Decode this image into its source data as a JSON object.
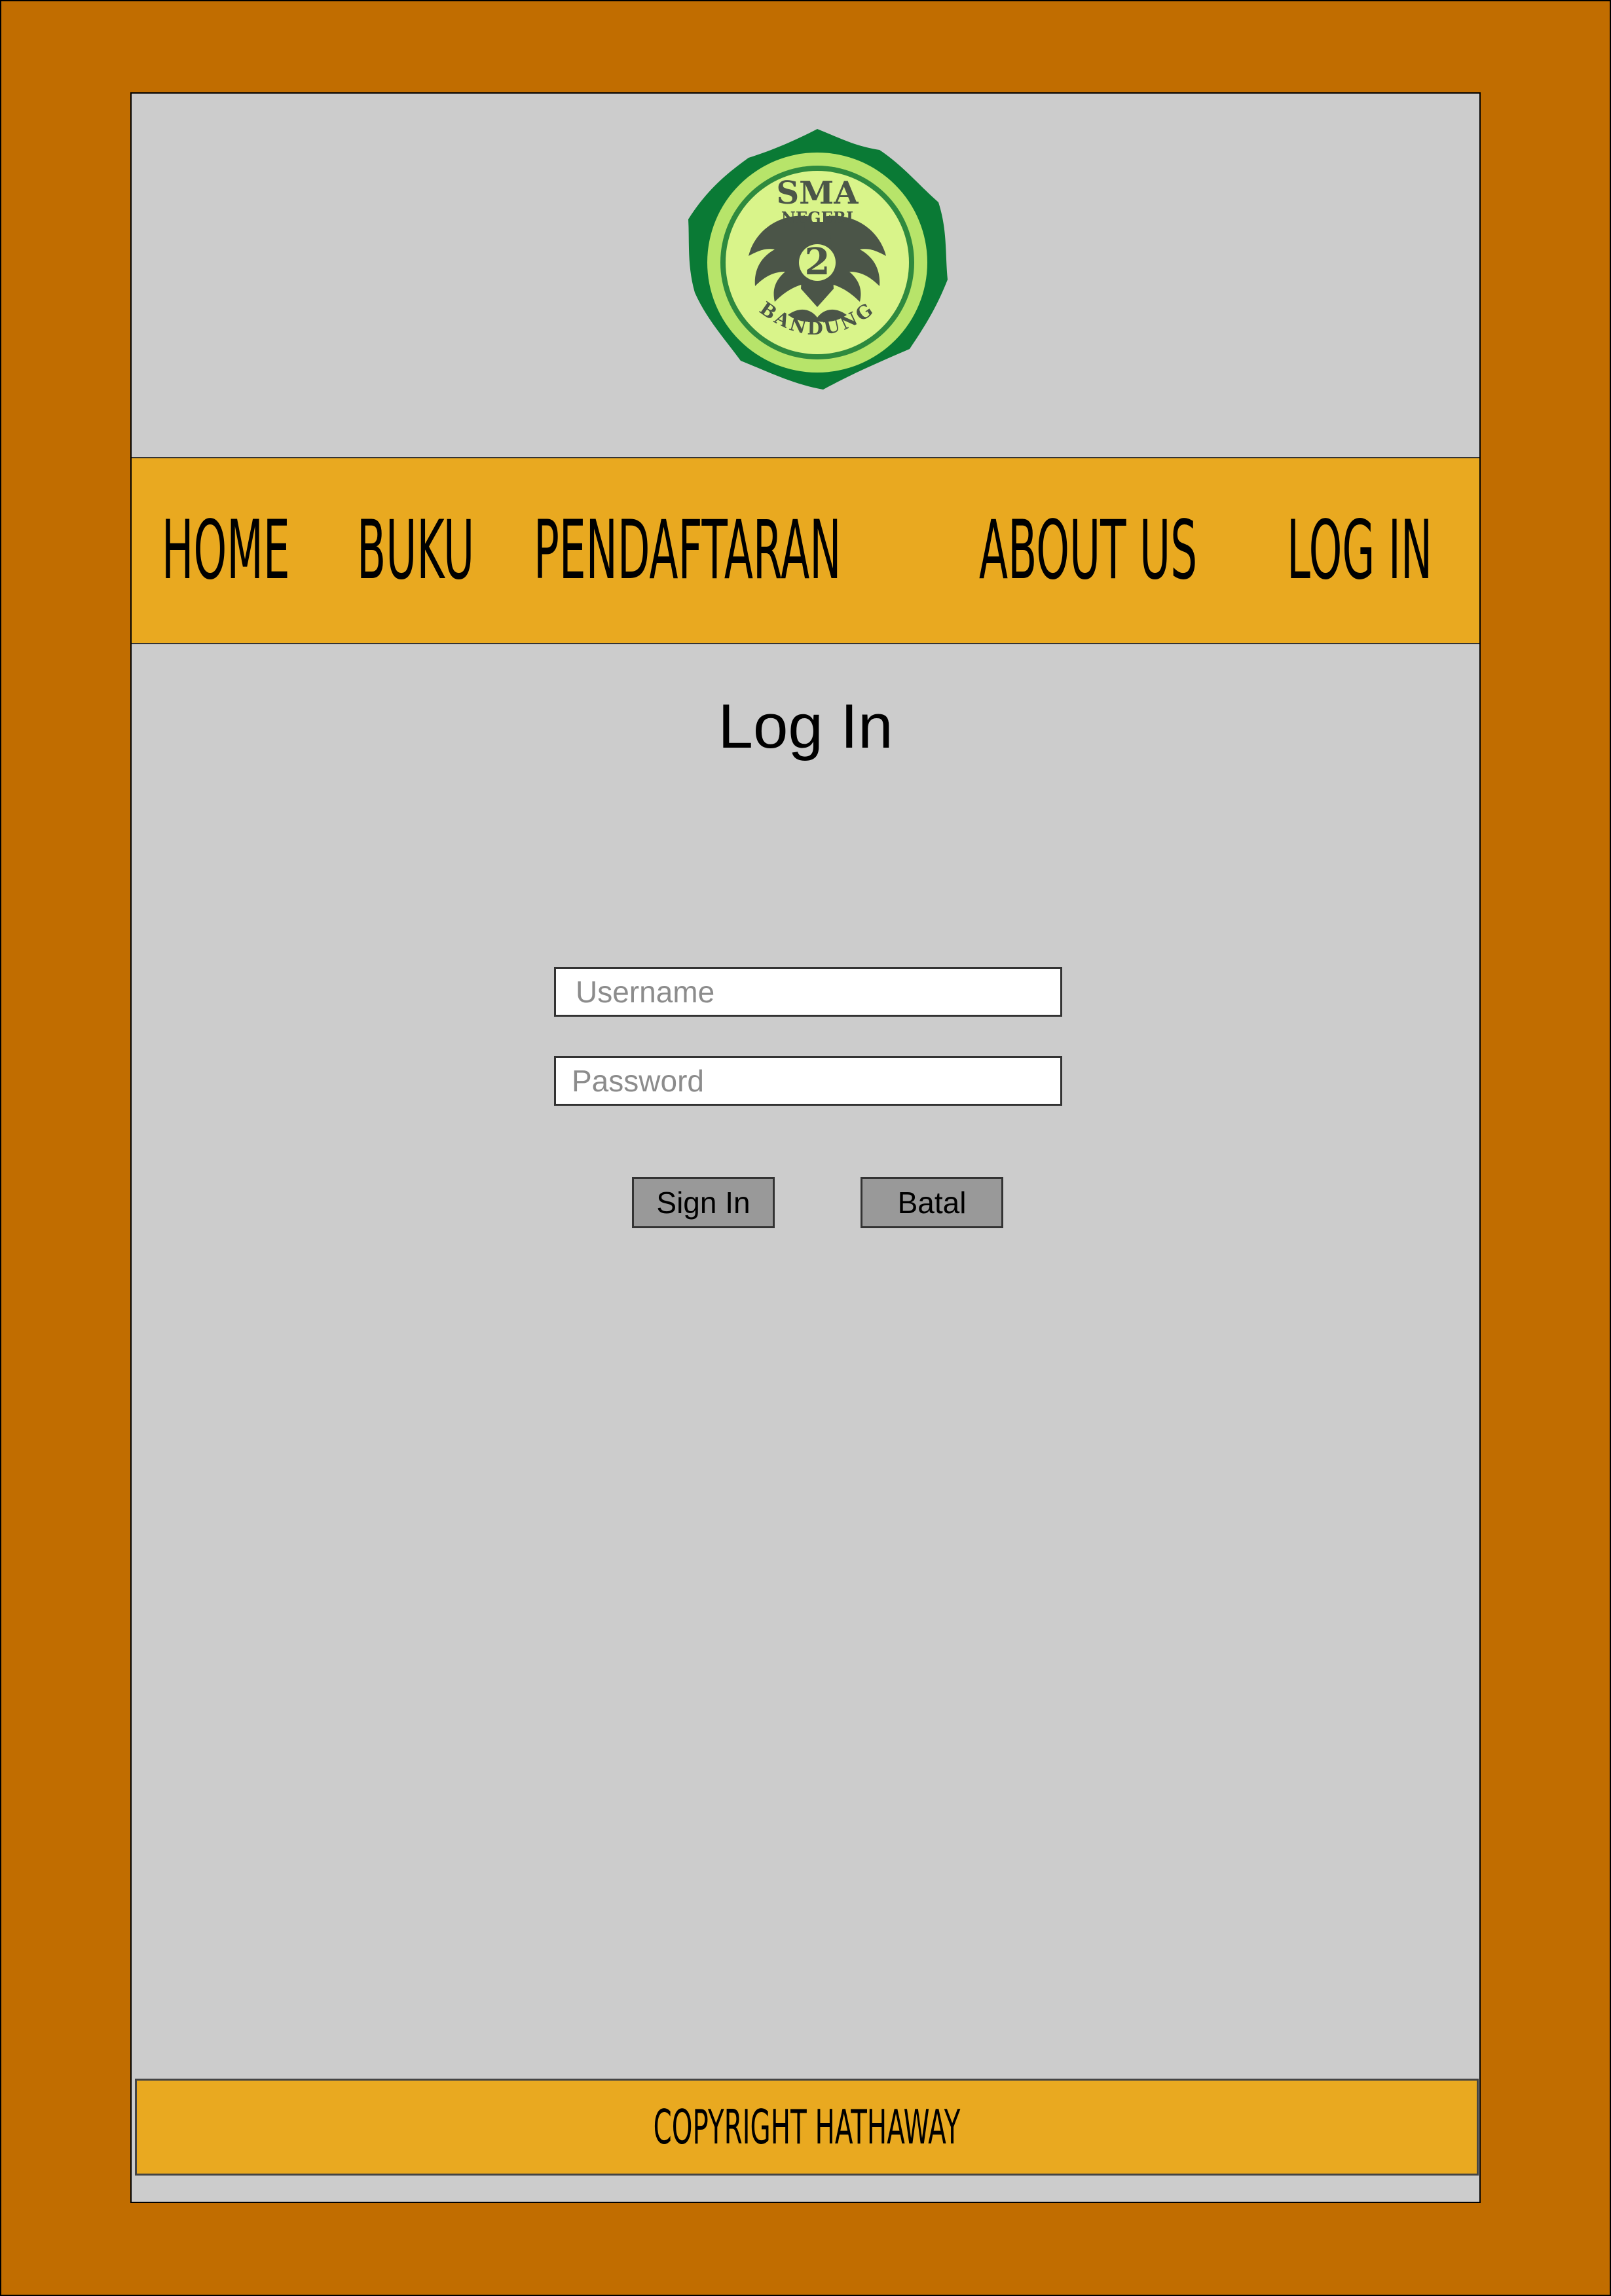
{
  "logo": {
    "line1": "SMA",
    "line2": "NEGERI",
    "number": "2",
    "city": "BANDUNG"
  },
  "nav": {
    "items": [
      {
        "label": "HOME"
      },
      {
        "label": "BUKU"
      },
      {
        "label": "PENDAFTARAN"
      },
      {
        "label": "ABOUT US"
      },
      {
        "label": "LOG IN"
      }
    ]
  },
  "main": {
    "title": "Log In",
    "username_placeholder": "Username",
    "password_placeholder": "Password",
    "signin_label": "Sign In",
    "cancel_label": "Batal"
  },
  "footer": {
    "text": "COPYRIGHT HATHAWAY"
  },
  "colors": {
    "frame": "#c16d00",
    "panel": "#cccccc",
    "bar": "#e9a920",
    "button": "#999999"
  }
}
